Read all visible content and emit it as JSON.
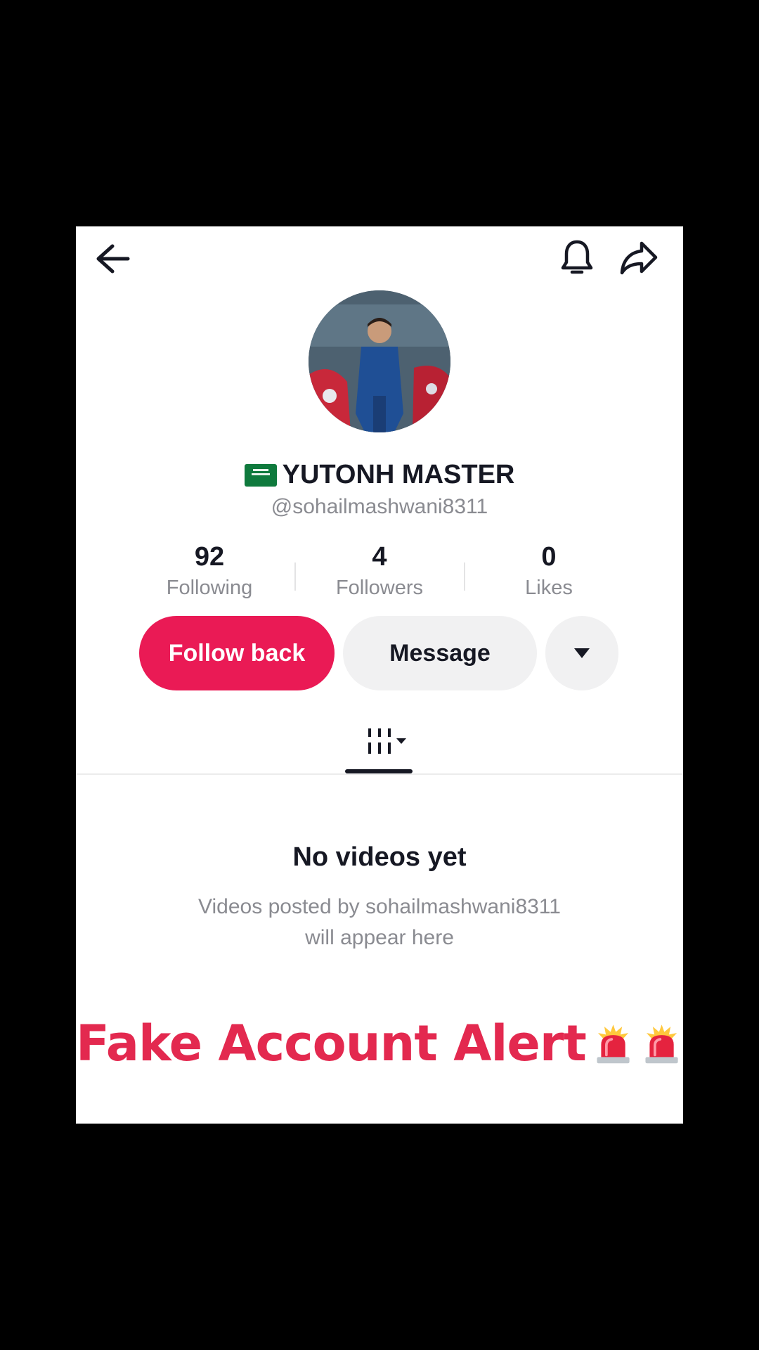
{
  "profile": {
    "display_name": "YUTONH MASTER",
    "username": "@sohailmashwani8311"
  },
  "stats": {
    "following": {
      "value": "92",
      "label": "Following"
    },
    "followers": {
      "value": "4",
      "label": "Followers"
    },
    "likes": {
      "value": "0",
      "label": "Likes"
    }
  },
  "actions": {
    "follow_label": "Follow back",
    "message_label": "Message"
  },
  "empty_state": {
    "title": "No videos yet",
    "line1": "Videos posted by sohailmashwani8311",
    "line2": "will appear here"
  },
  "overlay": {
    "alert_text": "Fake Account Alert"
  },
  "colors": {
    "follow_button": "#ea1a55",
    "alert_text": "#e3294f",
    "flag_green": "#0f7a3d"
  },
  "icons": [
    "back-arrow-icon",
    "bell-icon",
    "share-icon",
    "chevron-down-icon",
    "grid-tab-icon",
    "siren-icon",
    "saudi-flag-icon"
  ]
}
